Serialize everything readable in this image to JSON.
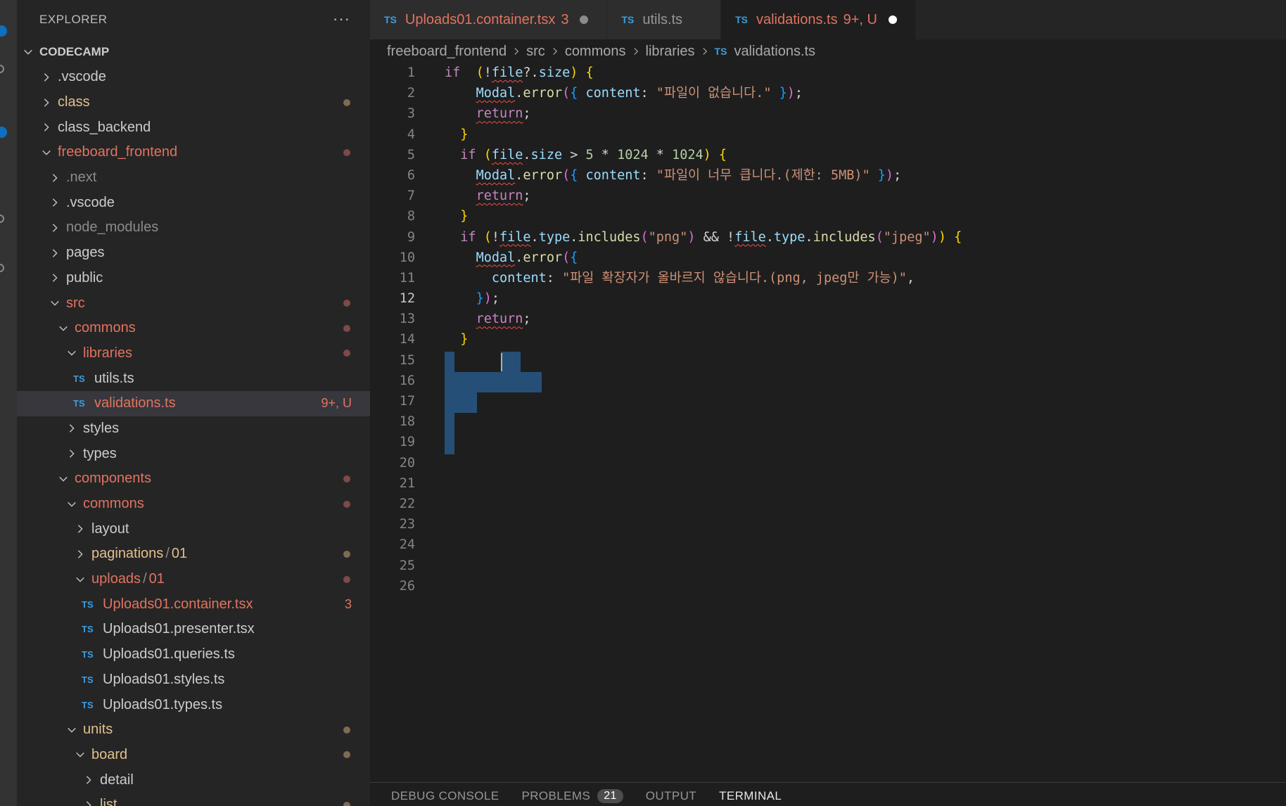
{
  "sidebar": {
    "header": "EXPLORER",
    "more": "···",
    "tree": [
      {
        "label": "CODECAMP",
        "kind": "root",
        "depth": 0,
        "chevron": "down"
      },
      {
        "label": ".vscode",
        "kind": "folder",
        "depth": 1,
        "chevron": "right"
      },
      {
        "label": "class",
        "kind": "folder",
        "depth": 1,
        "chevron": "right",
        "status": "orange",
        "dot": true
      },
      {
        "label": "class_backend",
        "kind": "folder",
        "depth": 1,
        "chevron": "right"
      },
      {
        "label": "freeboard_frontend",
        "kind": "folder",
        "depth": 1,
        "chevron": "down",
        "status": "modified",
        "dot": true
      },
      {
        "label": ".next",
        "kind": "folder",
        "depth": 2,
        "chevron": "right",
        "status": "dim"
      },
      {
        "label": ".vscode",
        "kind": "folder",
        "depth": 2,
        "chevron": "right"
      },
      {
        "label": "node_modules",
        "kind": "folder",
        "depth": 2,
        "chevron": "right",
        "status": "dim"
      },
      {
        "label": "pages",
        "kind": "folder",
        "depth": 2,
        "chevron": "right"
      },
      {
        "label": "public",
        "kind": "folder",
        "depth": 2,
        "chevron": "right"
      },
      {
        "label": "src",
        "kind": "folder",
        "depth": 2,
        "chevron": "down",
        "status": "modified",
        "dot": true
      },
      {
        "label": "commons",
        "kind": "folder",
        "depth": 3,
        "chevron": "down",
        "status": "modified",
        "dot": true
      },
      {
        "label": "libraries",
        "kind": "folder",
        "depth": 4,
        "chevron": "down",
        "status": "modified",
        "dot": true
      },
      {
        "label": "utils.ts",
        "kind": "file",
        "depth": 4
      },
      {
        "label": "validations.ts",
        "kind": "file",
        "depth": 4,
        "status": "untracked",
        "badge": "9+, U",
        "selected": true
      },
      {
        "label": "styles",
        "kind": "folder",
        "depth": 4,
        "chevron": "right"
      },
      {
        "label": "types",
        "kind": "folder",
        "depth": 4,
        "chevron": "right"
      },
      {
        "label": "components",
        "kind": "folder",
        "depth": 3,
        "chevron": "down",
        "status": "modified",
        "dot": true
      },
      {
        "label": "commons",
        "kind": "folder",
        "depth": 4,
        "chevron": "down",
        "status": "modified",
        "dot": true
      },
      {
        "label": "layout",
        "kind": "folder",
        "depth": 5,
        "chevron": "right"
      },
      {
        "label": "paginations",
        "label2": "01",
        "kind": "folder",
        "depth": 5,
        "chevron": "right",
        "status": "orange",
        "dot": true
      },
      {
        "label": "uploads",
        "label2": "01",
        "kind": "folder",
        "depth": 5,
        "chevron": "down",
        "status": "modified",
        "dot": true
      },
      {
        "label": "Uploads01.container.tsx",
        "kind": "file",
        "depth": 5,
        "status": "modified",
        "badge": "3"
      },
      {
        "label": "Uploads01.presenter.tsx",
        "kind": "file",
        "depth": 5
      },
      {
        "label": "Uploads01.queries.ts",
        "kind": "file",
        "depth": 5
      },
      {
        "label": "Uploads01.styles.ts",
        "kind": "file",
        "depth": 5
      },
      {
        "label": "Uploads01.types.ts",
        "kind": "file",
        "depth": 5
      },
      {
        "label": "units",
        "kind": "folder",
        "depth": 4,
        "chevron": "down",
        "status": "orange",
        "dot": true
      },
      {
        "label": "board",
        "kind": "folder",
        "depth": 5,
        "chevron": "down",
        "status": "orange",
        "dot": true
      },
      {
        "label": "detail",
        "kind": "folder",
        "depth": 6,
        "chevron": "right"
      },
      {
        "label": "list",
        "kind": "folder",
        "depth": 6,
        "chevron": "right",
        "status": "orange",
        "dot": true
      }
    ]
  },
  "tabs": [
    {
      "icon": "TS",
      "label": "Uploads01.container.tsx",
      "status": "3",
      "dirty": true,
      "active": false,
      "plain": false
    },
    {
      "icon": "TS",
      "label": "utils.ts",
      "status": "",
      "dirty": false,
      "active": false,
      "plain": true
    },
    {
      "icon": "TS",
      "label": "validations.ts",
      "status": "9+, U",
      "dirty": true,
      "active": true,
      "plain": false
    }
  ],
  "breadcrumb": {
    "items": [
      "freeboard_frontend",
      "src",
      "commons",
      "libraries"
    ],
    "file_icon": "TS",
    "file": "validations.ts"
  },
  "editor": {
    "current_line": 12,
    "line_count": 26,
    "lines": [
      [
        [
          "kw",
          "if"
        ],
        [
          "",
          "  "
        ],
        [
          "br1",
          "("
        ],
        [
          "",
          "!"
        ],
        [
          "vr squig",
          "file"
        ],
        [
          "",
          "?."
        ],
        [
          "vr",
          "size"
        ],
        [
          "br1",
          ")"
        ],
        [
          "",
          " "
        ],
        [
          "br1",
          "{"
        ]
      ],
      [
        [
          "",
          "    "
        ],
        [
          "vr squig",
          "Modal"
        ],
        [
          "",
          "."
        ],
        [
          "fn",
          "error"
        ],
        [
          "br2",
          "("
        ],
        [
          "br3",
          "{"
        ],
        [
          "",
          " "
        ],
        [
          "vr",
          "content"
        ],
        [
          "",
          ": "
        ],
        [
          "str",
          "\"파일이 없습니다.\""
        ],
        [
          "",
          " "
        ],
        [
          "br3",
          "}"
        ],
        [
          "br2",
          ")"
        ],
        [
          "",
          ";"
        ]
      ],
      [
        [
          "",
          "    "
        ],
        [
          "kw squig",
          "return"
        ],
        [
          "",
          ";"
        ]
      ],
      [
        [
          "",
          "  "
        ],
        [
          "br1",
          "}"
        ]
      ],
      [
        [
          "",
          "  "
        ],
        [
          "kw",
          "if"
        ],
        [
          "",
          " "
        ],
        [
          "br1",
          "("
        ],
        [
          "vr squig",
          "file"
        ],
        [
          "",
          "."
        ],
        [
          "vr",
          "size"
        ],
        [
          "",
          " > "
        ],
        [
          "num",
          "5"
        ],
        [
          "",
          " * "
        ],
        [
          "num",
          "1024"
        ],
        [
          "",
          " * "
        ],
        [
          "num",
          "1024"
        ],
        [
          "br1",
          ")"
        ],
        [
          "",
          " "
        ],
        [
          "br1",
          "{"
        ]
      ],
      [
        [
          "",
          "    "
        ],
        [
          "vr squig",
          "Modal"
        ],
        [
          "",
          "."
        ],
        [
          "fn",
          "error"
        ],
        [
          "br2",
          "("
        ],
        [
          "br3",
          "{"
        ],
        [
          "",
          " "
        ],
        [
          "vr",
          "content"
        ],
        [
          "",
          ": "
        ],
        [
          "str",
          "\"파일이 너무 큽니다.(제한: 5MB)\""
        ],
        [
          "",
          " "
        ],
        [
          "br3",
          "}"
        ],
        [
          "br2",
          ")"
        ],
        [
          "",
          ";"
        ]
      ],
      [
        [
          "",
          "    "
        ],
        [
          "kw squig",
          "return"
        ],
        [
          "",
          ";"
        ]
      ],
      [
        [
          "",
          "  "
        ],
        [
          "br1",
          "}"
        ]
      ],
      [
        [
          "",
          "  "
        ],
        [
          "kw",
          "if"
        ],
        [
          "",
          " "
        ],
        [
          "br1",
          "("
        ],
        [
          "",
          "!"
        ],
        [
          "vr squig",
          "file"
        ],
        [
          "",
          "."
        ],
        [
          "vr",
          "type"
        ],
        [
          "",
          "."
        ],
        [
          "fn",
          "includes"
        ],
        [
          "br2",
          "("
        ],
        [
          "str",
          "\"png\""
        ],
        [
          "br2",
          ")"
        ],
        [
          "",
          " && !"
        ],
        [
          "vr squig",
          "file"
        ],
        [
          "",
          "."
        ],
        [
          "vr",
          "type"
        ],
        [
          "",
          "."
        ],
        [
          "fn",
          "includes"
        ],
        [
          "br2",
          "("
        ],
        [
          "str",
          "\"jpeg\""
        ],
        [
          "br2",
          ")"
        ],
        [
          "br1",
          ")"
        ],
        [
          "",
          " "
        ],
        [
          "br1",
          "{"
        ]
      ],
      [
        [
          "",
          "    "
        ],
        [
          "vr squig",
          "Modal"
        ],
        [
          "",
          "."
        ],
        [
          "fn",
          "error"
        ],
        [
          "br2",
          "("
        ],
        [
          "br3",
          "{"
        ]
      ],
      [
        [
          "",
          "      "
        ],
        [
          "vr",
          "content"
        ],
        [
          "",
          ": "
        ],
        [
          "str",
          "\"파일 확장자가 올바르지 않습니다.(png, jpeg만 가능)\""
        ],
        [
          "",
          ","
        ]
      ],
      [
        [
          "",
          "    "
        ],
        [
          "br3",
          "}"
        ],
        [
          "br2",
          ")"
        ],
        [
          "",
          ";"
        ]
      ],
      [
        [
          "",
          "    "
        ],
        [
          "kw squig",
          "return"
        ],
        [
          "",
          ";"
        ]
      ],
      [
        [
          "",
          "  "
        ],
        [
          "br1",
          "}"
        ]
      ],
      [],
      [],
      [],
      [],
      [],
      [],
      [],
      [],
      [],
      [],
      [],
      []
    ]
  },
  "panel": {
    "tabs": [
      {
        "label": "DEBUG CONSOLE",
        "active": false
      },
      {
        "label": "PROBLEMS",
        "active": false,
        "badge": "21"
      },
      {
        "label": "OUTPUT",
        "active": false
      },
      {
        "label": "TERMINAL",
        "active": true
      }
    ]
  },
  "colors": {
    "accent": "#0e70c0",
    "modified": "#e2735e",
    "untracked": "#e2735e",
    "ignored": "#8b8b8b",
    "selection": "#264f78"
  }
}
